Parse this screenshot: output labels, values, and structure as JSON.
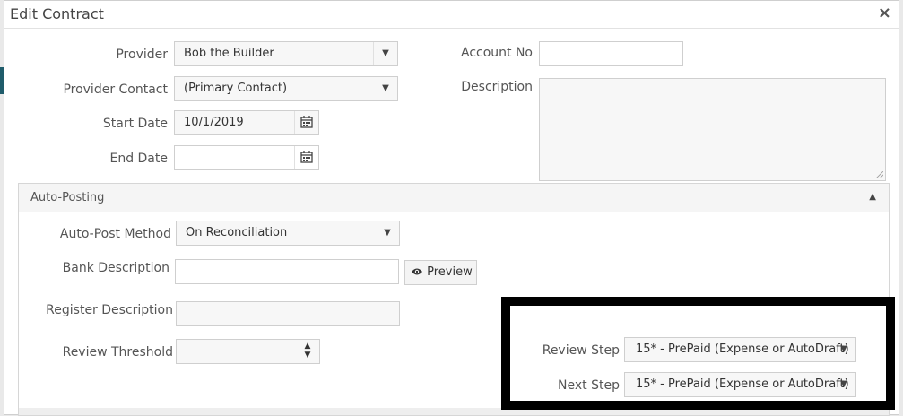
{
  "dialog": {
    "title": "Edit Contract",
    "close_symbol": "×"
  },
  "contract": {
    "provider_label": "Provider",
    "provider_value": "Bob the Builder",
    "provider_contact_label": "Provider Contact",
    "provider_contact_value": "(Primary Contact)",
    "start_date_label": "Start Date",
    "start_date_value": "10/1/2019",
    "end_date_label": "End Date",
    "end_date_value": "",
    "account_no_label": "Account No",
    "account_no_value": "",
    "description_label": "Description",
    "description_value": ""
  },
  "auto_posting": {
    "title": "Auto-Posting",
    "method_label": "Auto-Post Method",
    "method_value": "On Reconciliation",
    "bank_description_label": "Bank Description",
    "bank_description_value": "",
    "preview_label": "Preview",
    "register_description_label": "Register Description",
    "register_description_value": "",
    "review_threshold_label": "Review Threshold",
    "review_threshold_value": "",
    "review_step_label": "Review Step",
    "review_step_value": "15* - PrePaid (Expense or AutoDraft)",
    "next_step_label": "Next Step",
    "next_step_value": "15* - PrePaid (Expense or AutoDraft)"
  },
  "icons": {
    "calendar": "calendar-icon",
    "eye": "eye-icon",
    "caret": "caret-down-icon"
  },
  "colors": {
    "highlight_border": "#000000",
    "edge_strip": "#1f5c6b"
  }
}
